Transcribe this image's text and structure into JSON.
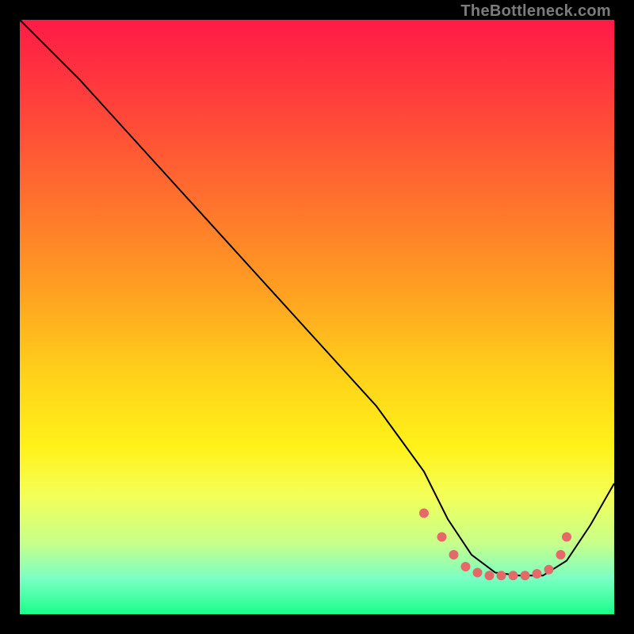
{
  "watermark": "TheBottleneck.com",
  "colors": {
    "dot": "#e46a6a",
    "line": "#000000"
  },
  "chart_data": {
    "type": "line",
    "title": "",
    "xlabel": "",
    "ylabel": "",
    "xlim": [
      0,
      100
    ],
    "ylim": [
      0,
      100
    ],
    "annotations": [
      "TheBottleneck.com"
    ],
    "series": [
      {
        "name": "curve",
        "x": [
          0,
          3,
          10,
          20,
          30,
          40,
          50,
          60,
          68,
          72,
          76,
          80,
          84,
          88,
          92,
          96,
          100
        ],
        "y": [
          100,
          97,
          90,
          79,
          68,
          57,
          46,
          35,
          24,
          16,
          10,
          7,
          6.5,
          6.5,
          9,
          15,
          22
        ]
      }
    ],
    "dots": {
      "x": [
        68,
        71,
        73,
        75,
        77,
        79,
        81,
        83,
        85,
        87,
        89,
        91,
        92
      ],
      "y": [
        17,
        13,
        10,
        8,
        7,
        6.5,
        6.5,
        6.5,
        6.5,
        6.8,
        7.5,
        10,
        13
      ]
    }
  }
}
